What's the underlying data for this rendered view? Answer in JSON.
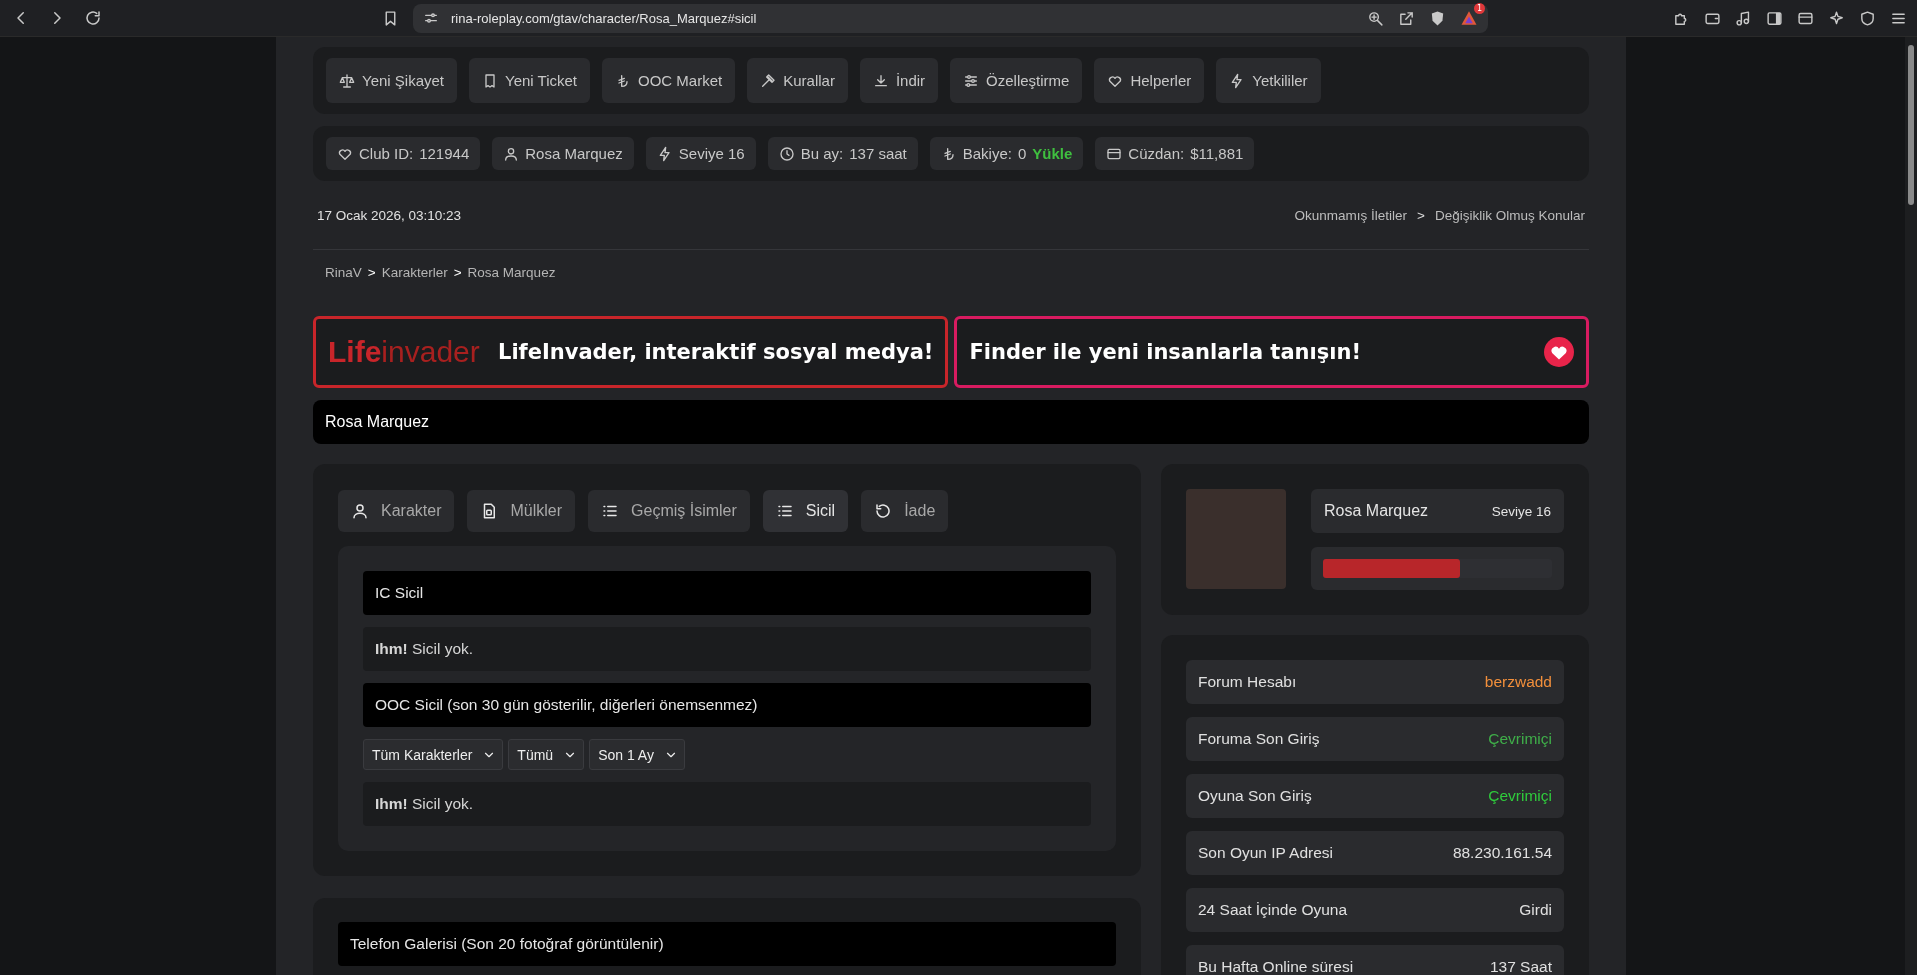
{
  "browser": {
    "url": "rina-roleplay.com/gtav/character/Rosa_Marquez#sicil",
    "badge": "1"
  },
  "nav": [
    {
      "label": "Yeni Şikayet"
    },
    {
      "label": "Yeni Ticket"
    },
    {
      "label": "OOC Market"
    },
    {
      "label": "Kurallar"
    },
    {
      "label": "İndir"
    },
    {
      "label": "Özelleştirme"
    },
    {
      "label": "Helperler"
    },
    {
      "label": "Yetkililer"
    }
  ],
  "info": [
    {
      "label": "Club ID:",
      "value": "121944"
    },
    {
      "value": "Rosa Marquez"
    },
    {
      "value": "Seviye 16"
    },
    {
      "label": "Bu ay:",
      "value": "137 saat"
    },
    {
      "label": "Bakiye:",
      "value": "0",
      "action": "Yükle"
    },
    {
      "label": "Cüzdan:",
      "value": "$11,881"
    }
  ],
  "datetime": "17 Ocak 2026, 03:10:23",
  "top_links": [
    {
      "kind": "link",
      "text": "Okunmamış İletiler"
    },
    {
      "kind": "separator",
      "text": ">"
    },
    {
      "kind": "link",
      "text": "Değişiklik Olmuş Konular"
    }
  ],
  "breadcrumb": [
    {
      "kind": "link",
      "text": "RinaV"
    },
    {
      "kind": "separator",
      "text": ">"
    },
    {
      "kind": "link",
      "text": "Karakterler"
    },
    {
      "kind": "separator",
      "text": ">"
    },
    {
      "kind": "current",
      "text": "Rosa Marquez"
    }
  ],
  "banner": {
    "logo_first": "Life",
    "logo_second": "invader",
    "left_text": "LifeInvader, interaktif sosyal medya!",
    "right_text": "Finder ile yeni insanlarla tanışın!"
  },
  "page_title": "Rosa Marquez",
  "tabs": [
    {
      "label": "Karakter",
      "selected": false
    },
    {
      "label": "Mülkler",
      "selected": false
    },
    {
      "label": "Geçmiş İsimler",
      "selected": false
    },
    {
      "label": "Sicil",
      "selected": true
    },
    {
      "label": "İade",
      "selected": false
    }
  ],
  "sections": [
    {
      "kind": "header",
      "text": "IC Sicil"
    },
    {
      "kind": "message",
      "text": "**Ihm!** Sicil yok."
    },
    {
      "kind": "header",
      "text": "OOC Sicil (son 30 gün gösterilir, diğerleri önemsenmez)"
    },
    {
      "kind": "filters",
      "filters": [
        "Tüm Karakterler",
        "Tümü",
        "Son 1 Ay"
      ]
    },
    {
      "kind": "message",
      "text": "**Ihm!** Sicil yok."
    }
  ],
  "gallery_title": "Telefon Galerisi (Son 20 fotoğraf görüntülenir)",
  "profile": {
    "name": "Rosa Marquez",
    "level_text": "Seviye 16",
    "level": 0.6
  },
  "stats": [
    {
      "label": "Forum Hesabı",
      "value": "berzwadd",
      "color": "#f28f3b"
    },
    {
      "label": "Foruma Son Giriş",
      "value": "Çevrimiçi",
      "color": "#3fae49"
    },
    {
      "label": "Oyuna Son Giriş",
      "value": "Çevrimiçi",
      "color": "#2fcb3c"
    },
    {
      "label": "Son Oyun IP Adresi",
      "value": "88.230.161.54"
    },
    {
      "label": "24 Saat İçinde Oyuna",
      "value": "Girdi"
    },
    {
      "label": "Bu Hafta Online süresi",
      "value": "137 Saat"
    }
  ]
}
